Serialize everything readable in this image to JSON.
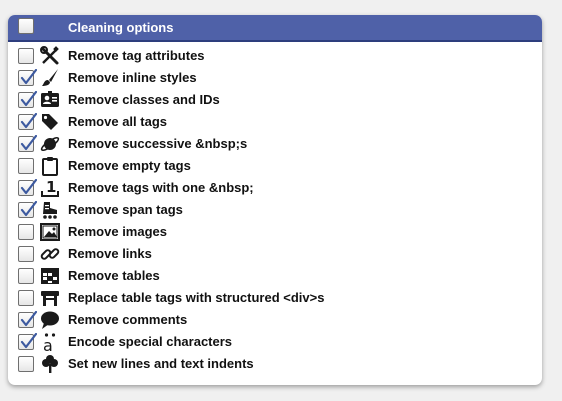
{
  "header": {
    "title": "Cleaning options",
    "checked": false
  },
  "colors": {
    "header_bg": "#4f61a8",
    "check": "#3d5aa0",
    "icon": "#1a1a1a"
  },
  "options": [
    {
      "label": "Remove tag attributes",
      "checked": false,
      "icon": "tools-icon"
    },
    {
      "label": "Remove inline styles",
      "checked": true,
      "icon": "paintbrush-icon"
    },
    {
      "label": "Remove classes and IDs",
      "checked": true,
      "icon": "id-card-icon"
    },
    {
      "label": "Remove all tags",
      "checked": true,
      "icon": "tag-icon"
    },
    {
      "label": "Remove successive &nbsp;s",
      "checked": true,
      "icon": "planet-icon"
    },
    {
      "label": "Remove empty tags",
      "checked": false,
      "icon": "clipboard-icon"
    },
    {
      "label": "Remove tags with one &nbsp;",
      "checked": true,
      "icon": "number-one-icon"
    },
    {
      "label": "Remove span tags",
      "checked": true,
      "icon": "skate-icon"
    },
    {
      "label": "Remove images",
      "checked": false,
      "icon": "image-icon"
    },
    {
      "label": "Remove links",
      "checked": false,
      "icon": "link-icon"
    },
    {
      "label": "Remove tables",
      "checked": false,
      "icon": "table-icon"
    },
    {
      "label": "Replace table tags with structured <div>s",
      "checked": false,
      "icon": "table-furniture-icon"
    },
    {
      "label": "Remove comments",
      "checked": true,
      "icon": "comment-icon"
    },
    {
      "label": "Encode special characters",
      "checked": true,
      "icon": "a-umlaut-icon"
    },
    {
      "label": "Set new lines and text indents",
      "checked": false,
      "icon": "tree-icon"
    }
  ]
}
